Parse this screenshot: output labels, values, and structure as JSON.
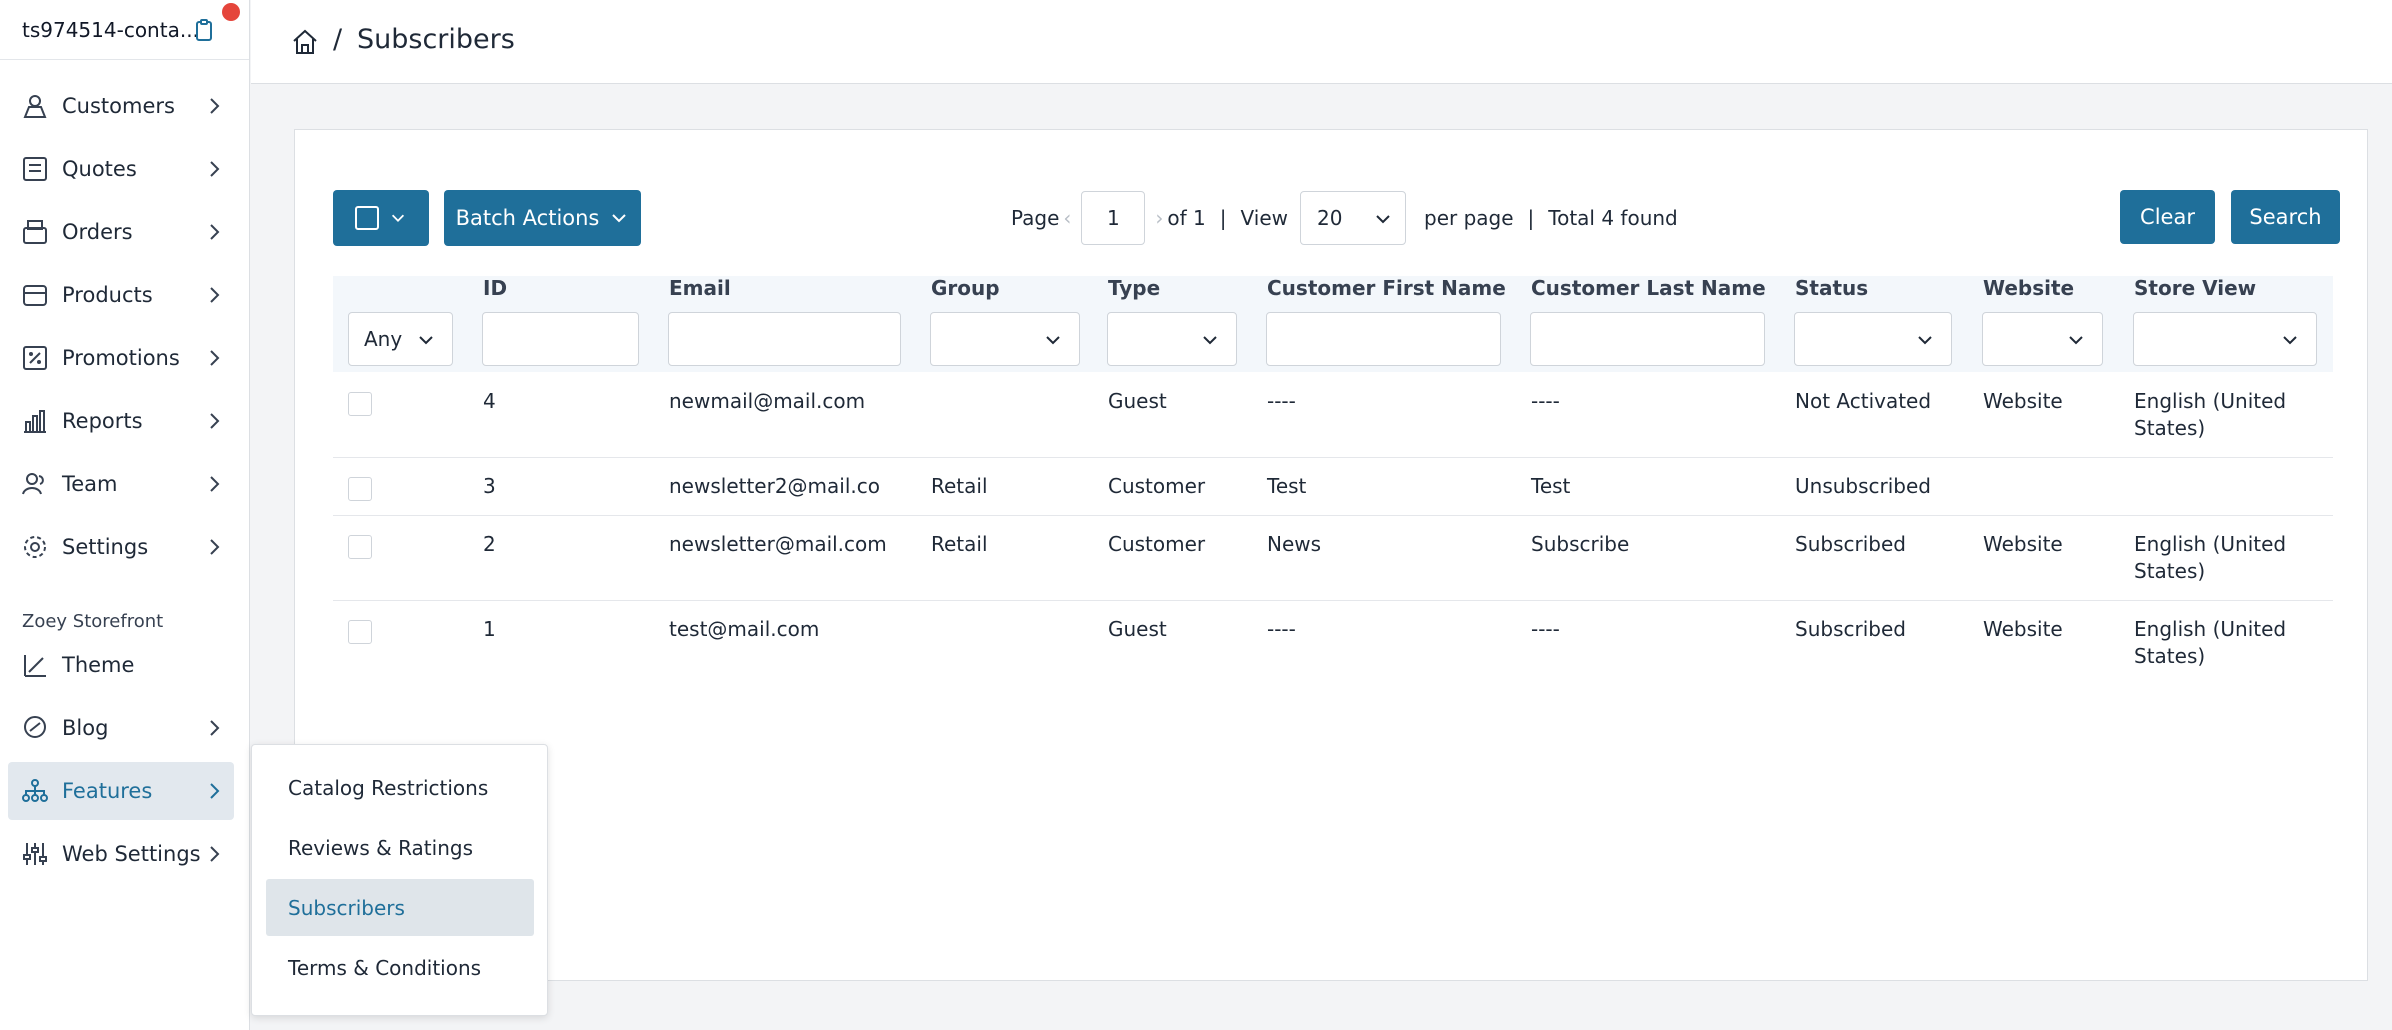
{
  "store": {
    "name": "ts974514-conta...",
    "icon": "clipboard-icon"
  },
  "sidebar": {
    "items": [
      {
        "label": "Customers",
        "icon": "customers-icon"
      },
      {
        "label": "Quotes",
        "icon": "quotes-icon"
      },
      {
        "label": "Orders",
        "icon": "orders-icon"
      },
      {
        "label": "Products",
        "icon": "products-icon"
      },
      {
        "label": "Promotions",
        "icon": "percent-icon"
      },
      {
        "label": "Reports",
        "icon": "chart-icon"
      },
      {
        "label": "Team",
        "icon": "team-icon"
      },
      {
        "label": "Settings",
        "icon": "gear-icon"
      }
    ],
    "section_label": "Zoey Storefront",
    "storefront_items": [
      {
        "label": "Theme",
        "icon": "brush-icon"
      },
      {
        "label": "Blog",
        "icon": "blog-icon"
      },
      {
        "label": "Features",
        "icon": "features-icon",
        "active": true
      },
      {
        "label": "Web Settings",
        "icon": "sliders-icon"
      }
    ]
  },
  "header": {
    "separator": "/",
    "title": "Subscribers"
  },
  "toolbar": {
    "batch_label": "Batch Actions",
    "page_label": "Page",
    "page_value": "1",
    "of_label": "of 1",
    "sep1": "|",
    "view_label": "View",
    "view_value": "20",
    "per_page_label": "per page",
    "sep2": "|",
    "total_label": "Total 4 found",
    "clear_label": "Clear",
    "search_label": "Search"
  },
  "grid": {
    "columns": [
      "ID",
      "Email",
      "Group",
      "Type",
      "Customer First Name",
      "Customer Last Name",
      "Status",
      "Website",
      "Store View"
    ],
    "any_filter": "Any",
    "rows": [
      {
        "id": "4",
        "email": "newmail@mail.com",
        "group": "",
        "type": "Guest",
        "first": "----",
        "last": "----",
        "status": "Not Activated",
        "website": "Website",
        "store_view": "English (United States)"
      },
      {
        "id": "3",
        "email": "newsletter2@mail.co",
        "group": "Retail",
        "type": "Customer",
        "first": "Test",
        "last": "Test",
        "status": "Unsubscribed",
        "website": "",
        "store_view": ""
      },
      {
        "id": "2",
        "email": "newsletter@mail.com",
        "group": "Retail",
        "type": "Customer",
        "first": "News",
        "last": "Subscribe",
        "status": "Subscribed",
        "website": "Website",
        "store_view": "English (United States)"
      },
      {
        "id": "1",
        "email": "test@mail.com",
        "group": "",
        "type": "Guest",
        "first": "----",
        "last": "----",
        "status": "Subscribed",
        "website": "Website",
        "store_view": "English (United States)"
      }
    ]
  },
  "flyout": {
    "items": [
      {
        "label": "Catalog Restrictions"
      },
      {
        "label": "Reviews & Ratings"
      },
      {
        "label": "Subscribers",
        "active": true
      },
      {
        "label": "Terms & Conditions"
      }
    ]
  },
  "colors": {
    "accent": "#1f6f9a",
    "notification": "#e5453b",
    "active_bg": "#e2e8ee"
  }
}
